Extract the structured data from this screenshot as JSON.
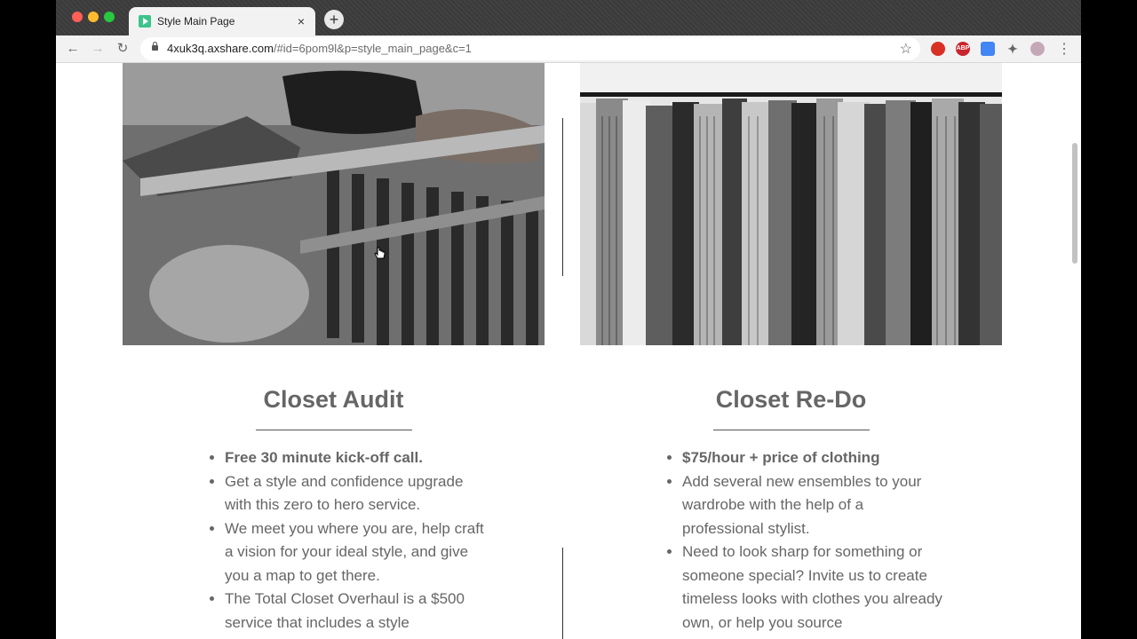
{
  "browser": {
    "tab_title": "Style Main Page",
    "tab_close": "×",
    "new_tab": "+",
    "url_host": "4xuk3q.axshare.com",
    "url_rest": "/#id=6pom9l&p=style_main_page&c=1",
    "nav": {
      "back": "←",
      "forward": "→",
      "reload": "↻",
      "bookmark": "☆",
      "menu": "⋮"
    },
    "extension_labels": [
      "",
      "ABP",
      "",
      "",
      ""
    ]
  },
  "page": {
    "left_card": {
      "image_icon": "accessories-photo",
      "title": "Closet Audit",
      "items": [
        {
          "text": "Free 30 minute kick-off call.",
          "bold": true
        },
        {
          "text": "Get a style and confidence upgrade with this zero to hero service.",
          "bold": false
        },
        {
          "text": "We meet you where you are, help craft a vision for your ideal style, and give you a map to get there.",
          "bold": false
        },
        {
          "text": "The Total Closet Overhaul is a $500 service that includes a style",
          "bold": false
        }
      ]
    },
    "right_card": {
      "image_icon": "clothing-rack-photo",
      "title": "Closet Re-Do",
      "items": [
        {
          "text": "$75/hour + price of clothing",
          "bold": true
        },
        {
          "text": "Add several new ensembles to your wardrobe with the help of a professional stylist.",
          "bold": false
        },
        {
          "text": "Need to look sharp for something or someone special? Invite us to create timeless looks with clothes you already own, or help you source",
          "bold": false
        }
      ]
    }
  },
  "colors": {
    "heading": "#666666",
    "body_text": "#666666",
    "titlebar": "#3c3c3c",
    "tab": "#f2f2f2"
  }
}
